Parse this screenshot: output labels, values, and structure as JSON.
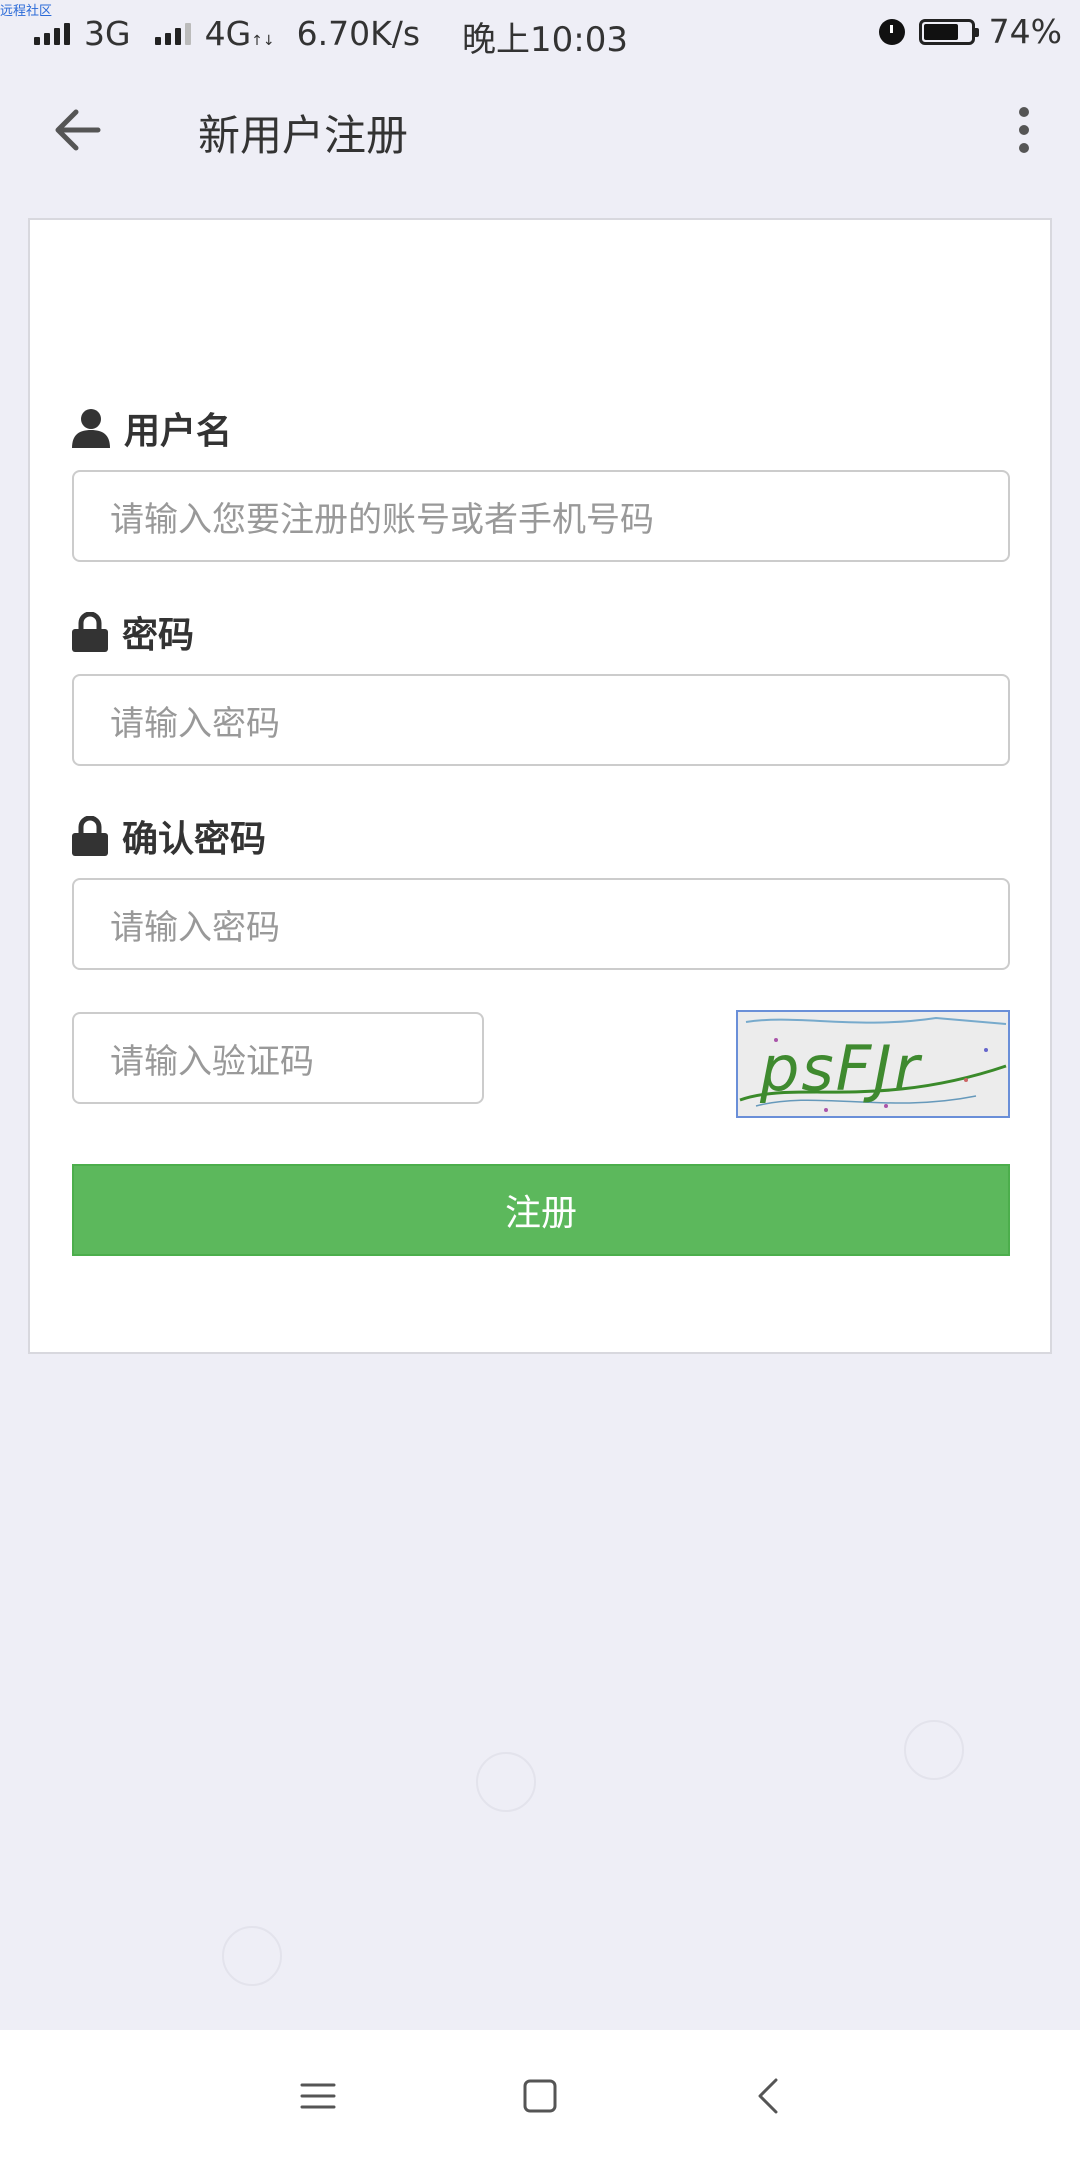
{
  "watermark": "远程社区",
  "status_bar": {
    "network1": "3G",
    "network2": "4G",
    "network2_suffix": "↑↓",
    "speed": "6.70K/s",
    "time": "晚上10:03",
    "battery": "74%",
    "battery_level": 0.74
  },
  "header": {
    "title": "新用户注册",
    "back_icon": "arrow-left-icon",
    "menu_icon": "more-vertical-icon"
  },
  "form": {
    "username": {
      "label": "用户名",
      "placeholder": "请输入您要注册的账号或者手机号码",
      "icon": "user-icon"
    },
    "password": {
      "label": "密码",
      "placeholder": "请输入密码",
      "icon": "lock-icon"
    },
    "confirm_password": {
      "label": "确认密码",
      "placeholder": "请输入密码",
      "icon": "lock-icon"
    },
    "captcha": {
      "placeholder": "请输入验证码",
      "image_text": "psFJr"
    },
    "submit_label": "注册"
  },
  "colors": {
    "background": "#eeeef6",
    "primary_button": "#5cb85c",
    "card": "#ffffff"
  },
  "nav_bar": {
    "menu_icon": "menu-icon",
    "home_icon": "square-home-icon",
    "back_icon": "chevron-left-icon"
  }
}
